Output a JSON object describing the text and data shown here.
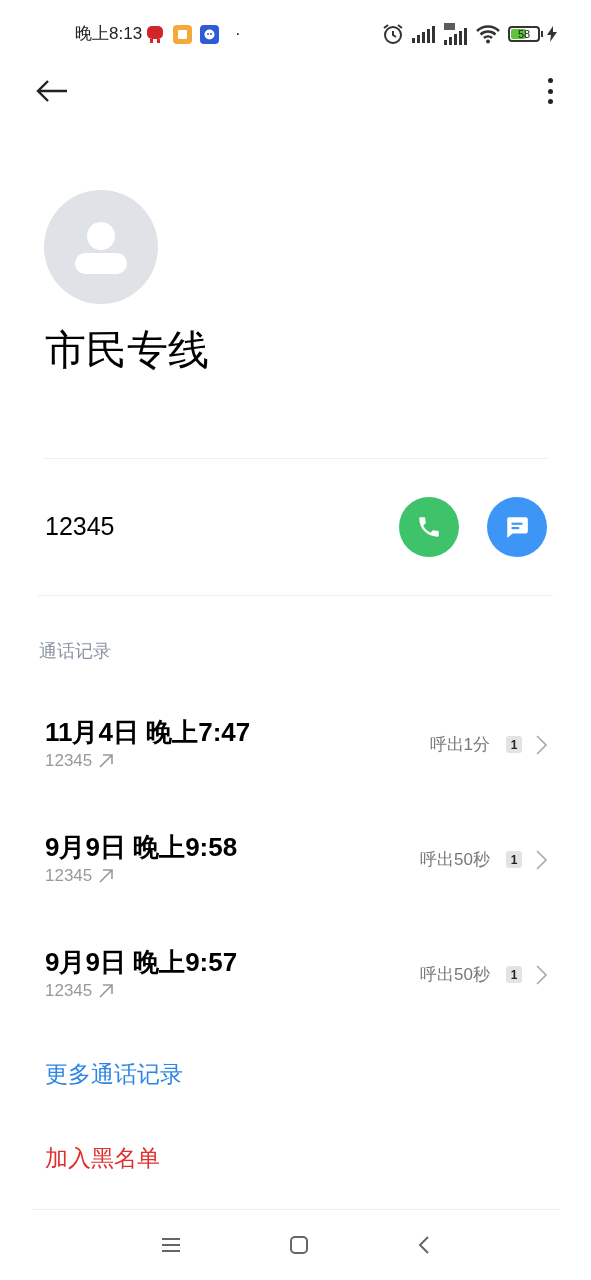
{
  "status_bar": {
    "time": "晚上8:13",
    "dot": "·",
    "battery": "58"
  },
  "contact": {
    "name": "市民专线",
    "number": "12345"
  },
  "section_title": "通话记录",
  "calls": [
    {
      "date": "11月4日 晚上7:47",
      "number": "12345",
      "summary": "呼出1分",
      "count": "1"
    },
    {
      "date": "9月9日 晚上9:58",
      "number": "12345",
      "summary": "呼出50秒",
      "count": "1"
    },
    {
      "date": "9月9日 晚上9:57",
      "number": "12345",
      "summary": "呼出50秒",
      "count": "1"
    }
  ],
  "actions": [
    {
      "label": "更多通话记录",
      "kind": "link"
    },
    {
      "label": "加入黑名单",
      "kind": "danger"
    }
  ]
}
